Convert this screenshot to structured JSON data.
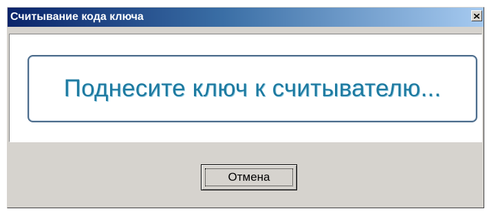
{
  "window": {
    "title": "Считывание кода ключа",
    "close_icon": "close-icon"
  },
  "content": {
    "prompt": "Поднесите ключ к считывателю..."
  },
  "buttons": {
    "cancel_label": "Отмена"
  },
  "colors": {
    "titlebar_start": "#0a246a",
    "titlebar_end": "#a6caf0",
    "prompt_text": "#1e7aa0",
    "dialog_bg": "#d6d3ce"
  }
}
